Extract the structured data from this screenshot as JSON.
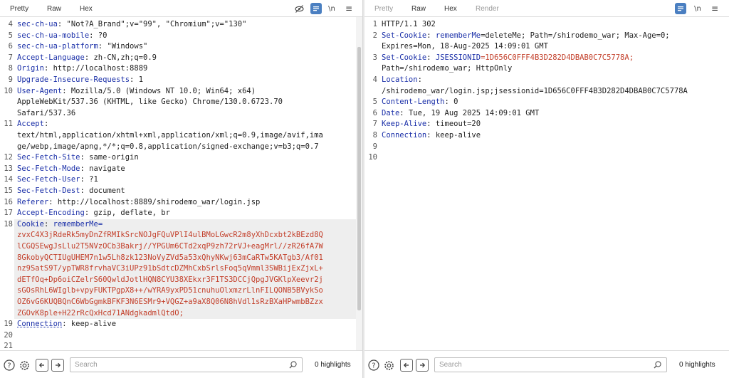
{
  "request": {
    "tabs": [
      "Pretty",
      "Raw",
      "Hex"
    ],
    "active_tab": "Pretty",
    "newline_label": "\\n",
    "menu_label": "≡",
    "lines": [
      {
        "n": "4",
        "key": "sec-ch-ua",
        "value": ": \"Not?A_Brand\";v=\"99\", \"Chromium\";v=\"130\""
      },
      {
        "n": "5",
        "key": "sec-ch-ua-mobile",
        "value": ": ?0"
      },
      {
        "n": "6",
        "key": "sec-ch-ua-platform",
        "value": ": \"Windows\""
      },
      {
        "n": "7",
        "key": "Accept-Language",
        "value": ": zh-CN,zh;q=0.9"
      },
      {
        "n": "8",
        "key": "Origin",
        "value": ": http://localhost:8889"
      },
      {
        "n": "9",
        "key": "Upgrade-Insecure-Requests",
        "value": ": 1"
      },
      {
        "n": "10",
        "key": "User-Agent",
        "value": ": Mozilla/5.0 (Windows NT 10.0; Win64; x64)"
      },
      {
        "n": "",
        "key": "",
        "value": "AppleWebKit/537.36 (KHTML, like Gecko) Chrome/130.0.6723.70"
      },
      {
        "n": "",
        "key": "",
        "value": "Safari/537.36"
      },
      {
        "n": "11",
        "key": "Accept",
        "value": ":"
      },
      {
        "n": "",
        "key": "",
        "value": "text/html,application/xhtml+xml,application/xml;q=0.9,image/avif,ima"
      },
      {
        "n": "",
        "key": "",
        "value": "ge/webp,image/apng,*/*;q=0.8,application/signed-exchange;v=b3;q=0.7"
      },
      {
        "n": "12",
        "key": "Sec-Fetch-Site",
        "value": ": same-origin"
      },
      {
        "n": "13",
        "key": "Sec-Fetch-Mode",
        "value": ": navigate"
      },
      {
        "n": "14",
        "key": "Sec-Fetch-User",
        "value": ": ?1"
      },
      {
        "n": "15",
        "key": "Sec-Fetch-Dest",
        "value": ": document"
      },
      {
        "n": "16",
        "key": "Referer",
        "value": ": http://localhost:8889/shirodemo_war/login.jsp"
      },
      {
        "n": "17",
        "key": "Accept-Encoding",
        "value": ": gzip, deflate, br"
      }
    ],
    "cookie": {
      "n": "18",
      "key": "Cookie",
      "sep": ": ",
      "name": "rememberMe",
      "eq": "=",
      "value_lines": [
        "zvxC4X3jRdeRk5myDnZfRMIkSrcNOJgFQuVPlI4ulBMoLGwcR2m8yXhDcxbt2kBEzd8Q",
        "lCGQSEwgJsLlu2T5NVzOCb3Bakrj//YPGUm6CTd2xqP9zh72rVJ+eagMrl//zR26fA7W",
        "8GkobyQCTIUgUHEM7n1w5Lh8zk123NoVyZVd5a53xQhyNKwj63mCaRTw5KATgb3/Af01",
        "nz9SatS9T/ypTWR8frvhaVC3iUPz91bSdtcDZMhCxbSrlsFoq5qVmml3SWBijExZjxL+",
        "dETfOq+Dp6oiCZelrS60QwldJotlHQN8CYU38XEkxr3F1TS3DCCjQpgJVGKlpXeevr2j",
        "sGOsRhL6WIglb+vpyFUKTPgpX8++/wYRA9yxPD51cnuhuOlxmzrLlnFILQONB5BVykSo",
        "OZ6vG6KUQBQnC6WbGgmkBFKF3N6ESMr9+VQGZ+a9aX8Q06N8hVdl1sRzBXaHPwmbBZzx",
        "ZGOvK8ple+H22rRcQxHcd71ANdgkadmlQtdO;"
      ]
    },
    "tail_lines": [
      {
        "n": "19",
        "key": "Connection",
        "value": ": keep-alive"
      },
      {
        "n": "20",
        "key": "",
        "value": ""
      },
      {
        "n": "21",
        "key": "",
        "value": ""
      }
    ],
    "search_placeholder": "Search",
    "highlights": "0 highlights",
    "help_icon": "?",
    "scroll_fraction": 0.95
  },
  "response": {
    "tabs": [
      "Pretty",
      "Raw",
      "Hex",
      "Render"
    ],
    "active_tab": "Raw",
    "newline_label": "\\n",
    "menu_label": "≡",
    "lines": [
      {
        "n": "1",
        "key": "",
        "value": "HTTP/1.1 302"
      },
      {
        "n": "2",
        "key": "Set-Cookie",
        "value": ": ",
        "extra_key": "rememberMe",
        "extra_value": "=deleteMe; Path=/shirodemo_war; Max-Age=0;"
      },
      {
        "n": "",
        "key": "",
        "value": "Expires=Mon, 18-Aug-2025 14:09:01 GMT"
      },
      {
        "n": "3",
        "key": "Set-Cookie",
        "value": ": ",
        "extra_key": "JSESSIONID",
        "extra_value": "=1D656C0FFF4B3D282D4DBAB0C7C5778A;",
        "extra_red": true
      },
      {
        "n": "",
        "key": "",
        "value": "Path=/shirodemo_war; HttpOnly"
      },
      {
        "n": "4",
        "key": "Location",
        "value": ":"
      },
      {
        "n": "",
        "key": "",
        "value": "/shirodemo_war/login.jsp;jsessionid=1D656C0FFF4B3D282D4DBAB0C7C5778A"
      },
      {
        "n": "5",
        "key": "Content-Length",
        "value": ": 0"
      },
      {
        "n": "6",
        "key": "Date",
        "value": ": Tue, 19 Aug 2025 14:09:01 GMT"
      },
      {
        "n": "7",
        "key": "Keep-Alive",
        "value": ": timeout=20"
      },
      {
        "n": "8",
        "key": "Connection",
        "value": ": keep-alive"
      },
      {
        "n": "9",
        "key": "",
        "value": ""
      },
      {
        "n": "10",
        "key": "",
        "value": ""
      }
    ],
    "search_placeholder": "Search",
    "highlights": "0 highlights",
    "help_icon": "?"
  },
  "colors": {
    "accent_tab": "#e8633a",
    "header_key": "#1a2fa8",
    "cookie_value": "#c33f2a",
    "tool_active": "#4a7fc1"
  }
}
